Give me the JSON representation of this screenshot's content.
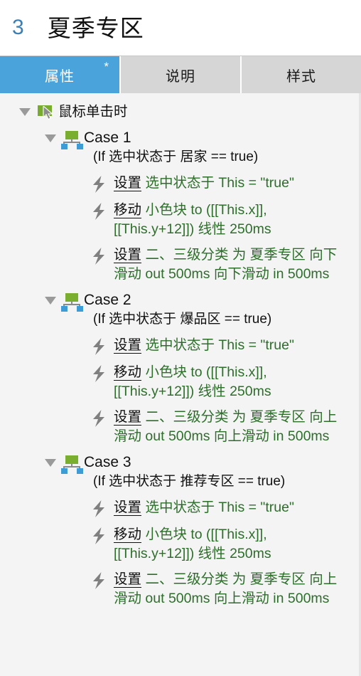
{
  "header": {
    "index": "3",
    "title": "夏季专区"
  },
  "tabs": [
    {
      "label": "属性",
      "star": "*",
      "active": true
    },
    {
      "label": "说明",
      "star": "",
      "active": false
    },
    {
      "label": "样式",
      "star": "",
      "active": false
    }
  ],
  "colors": {
    "accent_blue": "#4ba3db",
    "index_blue": "#3a80b6",
    "action_green": "#2d6e2a",
    "tab_inactive": "#d6d6d6",
    "panel_bg": "#f4f4f4",
    "icon_green": "#79ae2f",
    "icon_blue": "#3d9bd6",
    "icon_gray": "#8a8a8a"
  },
  "icons": {
    "event": "mouse-click-icon",
    "case": "case-branch-icon",
    "action": "lightning-bolt-icon",
    "expand": "triangle-down-icon"
  },
  "tree": {
    "event": {
      "label": "鼠标单击时",
      "expanded": true
    },
    "cases": [
      {
        "title": "Case 1",
        "condition": "(If 选中状态于 居家 == true)",
        "expanded": true,
        "actions": [
          {
            "verb": "设置",
            "target": "选中状态于 This = \"true\""
          },
          {
            "verb": "移动",
            "target": "小色块 to ([[This.x]], [[This.y+12]]) 线性 250ms"
          },
          {
            "verb": "设置",
            "target": "二、三级分类 为 夏季专区 向下滑动 out 500ms 向下滑动 in 500ms"
          }
        ]
      },
      {
        "title": "Case 2",
        "condition": "(If 选中状态于 爆品区 == true)",
        "expanded": true,
        "actions": [
          {
            "verb": "设置",
            "target": "选中状态于 This = \"true\""
          },
          {
            "verb": "移动",
            "target": "小色块 to ([[This.x]], [[This.y+12]]) 线性 250ms"
          },
          {
            "verb": "设置",
            "target": "二、三级分类 为 夏季专区 向上滑动 out 500ms 向上滑动 in 500ms"
          }
        ]
      },
      {
        "title": "Case 3",
        "condition": "(If 选中状态于 推荐专区 == true)",
        "expanded": true,
        "actions": [
          {
            "verb": "设置",
            "target": "选中状态于 This = \"true\""
          },
          {
            "verb": "移动",
            "target": "小色块 to ([[This.x]], [[This.y+12]]) 线性 250ms"
          },
          {
            "verb": "设置",
            "target": "二、三级分类 为 夏季专区 向上滑动 out 500ms 向上滑动 in 500ms"
          }
        ]
      }
    ]
  }
}
